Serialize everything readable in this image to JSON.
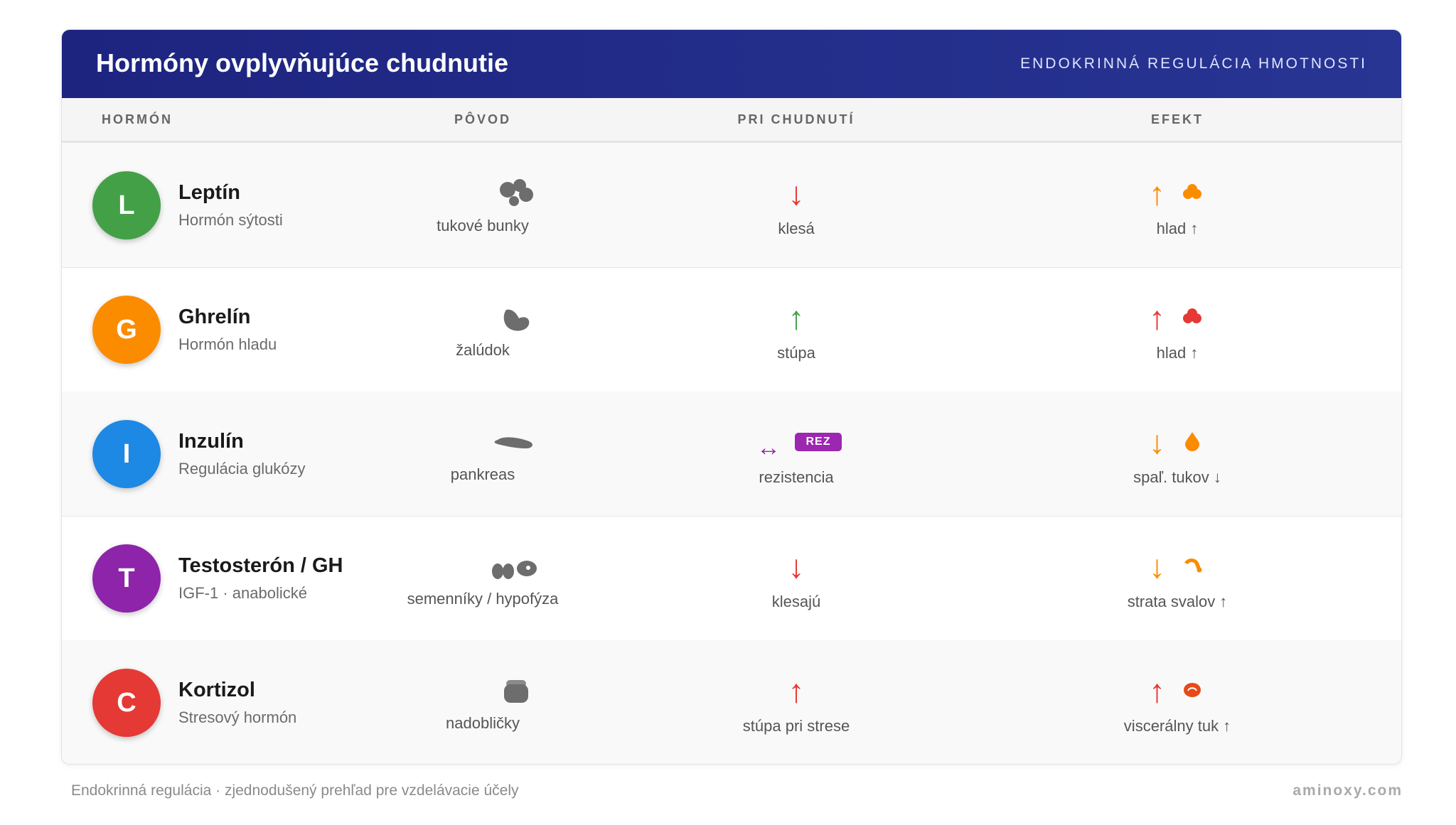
{
  "header": {
    "title": "Hormóny ovplyvňujúce chudnutie",
    "subtitle": "ENDOKRINNÁ REGULÁCIA HMOTNOSTI"
  },
  "columns": [
    "HORMÓN",
    "PÔVOD",
    "PRI CHUDNUTÍ",
    "EFEKT"
  ],
  "rows": [
    {
      "initial": "L",
      "name": "Leptín",
      "desc": "Hormón sýtosti",
      "color": "#43a047",
      "origin_icon": "fat-cells-icon",
      "origin": "tukové bunky",
      "change_arrow": "↓",
      "change_color": "#e53935",
      "change": "klesá",
      "effect_arrow": "↑",
      "effect_color": "#fb8c00",
      "effect_icon": "hunger-blob-icon",
      "effect": "hlad ↑"
    },
    {
      "initial": "G",
      "name": "Ghrelín",
      "desc": "Hormón hladu",
      "color": "#fb8c00",
      "origin_icon": "stomach-icon",
      "origin": "žalúdok",
      "change_arrow": "↑",
      "change_color": "#43a047",
      "change": "stúpa",
      "effect_arrow": "↑",
      "effect_color": "#e53935",
      "effect_icon": "hunger-blob-icon",
      "effect": "hlad ↑"
    },
    {
      "initial": "I",
      "name": "Inzulín",
      "desc": "Regulácia glukózy",
      "color": "#1e88e5",
      "origin_icon": "pancreas-icon",
      "origin": "pankreas",
      "change_arrow": "↔",
      "change_color": "#9c27b0",
      "change": "rezistencia",
      "badge": "REZ",
      "effect_arrow": "↓",
      "effect_color": "#fb8c00",
      "effect_icon": "drop-icon",
      "effect": "spaľ. tukov ↓"
    },
    {
      "initial": "T",
      "name": "Testosterón / GH",
      "desc": "IGF-1 · anabolické",
      "color": "#8e24aa",
      "origin_icon": "testes-pituitary-icon",
      "origin": "semenníky / hypofýza",
      "change_arrow": "↓",
      "change_color": "#e53935",
      "change": "klesajú",
      "effect_arrow": "↓",
      "effect_color": "#fb8c00",
      "effect_icon": "muscle-icon",
      "effect": "strata svalov ↑"
    },
    {
      "initial": "C",
      "name": "Kortizol",
      "desc": "Stresový hormón",
      "color": "#e53935",
      "origin_icon": "adrenal-icon",
      "origin": "nadobličky",
      "change_arrow": "↑",
      "change_color": "#e53935",
      "change": "stúpa pri strese",
      "effect_arrow": "↑",
      "effect_color": "#e53935",
      "effect_icon": "visceral-fat-icon",
      "effect": "viscerálny tuk ↑"
    }
  ],
  "footer": {
    "note": "Endokrinná regulácia · zjednodušený prehľad pre vzdelávacie účely",
    "brand": "aminoxy.com"
  }
}
